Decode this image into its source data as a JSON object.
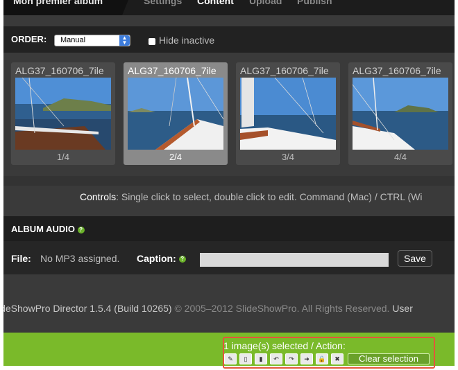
{
  "header": {
    "album_title": "Mon premier album",
    "tabs": [
      {
        "label": "Settings"
      },
      {
        "label": "Content"
      },
      {
        "label": "Upload"
      },
      {
        "label": "Publish"
      }
    ]
  },
  "order": {
    "label": "ORDER:",
    "selected": "Manual",
    "hide_inactive_label": "Hide inactive"
  },
  "thumbnails": [
    {
      "name": "ALG37_160706_7ile",
      "position": "1/4"
    },
    {
      "name": "ALG37_160706_7ile",
      "position": "2/4"
    },
    {
      "name": "ALG37_160706_7ile",
      "position": "3/4"
    },
    {
      "name": "ALG37_160706_7ile",
      "position": "4/4"
    }
  ],
  "controls": {
    "label": "Controls",
    "text": ": Single click to select, double click to edit. Command (Mac) / CTRL (Wi"
  },
  "audio": {
    "title": "ALBUM AUDIO",
    "help": "?",
    "file_label": "File:",
    "file_value": "No MP3 assigned.",
    "caption_label": "Caption:",
    "caption_value": "",
    "save_label": "Save"
  },
  "footer": {
    "text": "ideShowPro Director 1.5.4 (Build 10265) ",
    "copyright": "© 2005–2012 SlideShowPro. All Rights Reserved. ",
    "user": "User"
  },
  "selection": {
    "text": "1 image(s) selected  /  Action:",
    "actions": [
      {
        "icon": "pencil-icon",
        "glyph": "✎"
      },
      {
        "icon": "mobile-icon",
        "glyph": "▯"
      },
      {
        "icon": "tablet-icon",
        "glyph": "▮"
      },
      {
        "icon": "rotate-left-icon",
        "glyph": "↶"
      },
      {
        "icon": "rotate-right-icon",
        "glyph": "↷"
      },
      {
        "icon": "move-icon",
        "glyph": "➜"
      },
      {
        "icon": "lock-icon",
        "glyph": "🔒"
      },
      {
        "icon": "delete-icon",
        "glyph": "✖"
      }
    ],
    "clear_label": "Clear selection"
  },
  "colors": {
    "green_bar": "#7aba2a",
    "highlight_box": "#e3563b"
  }
}
